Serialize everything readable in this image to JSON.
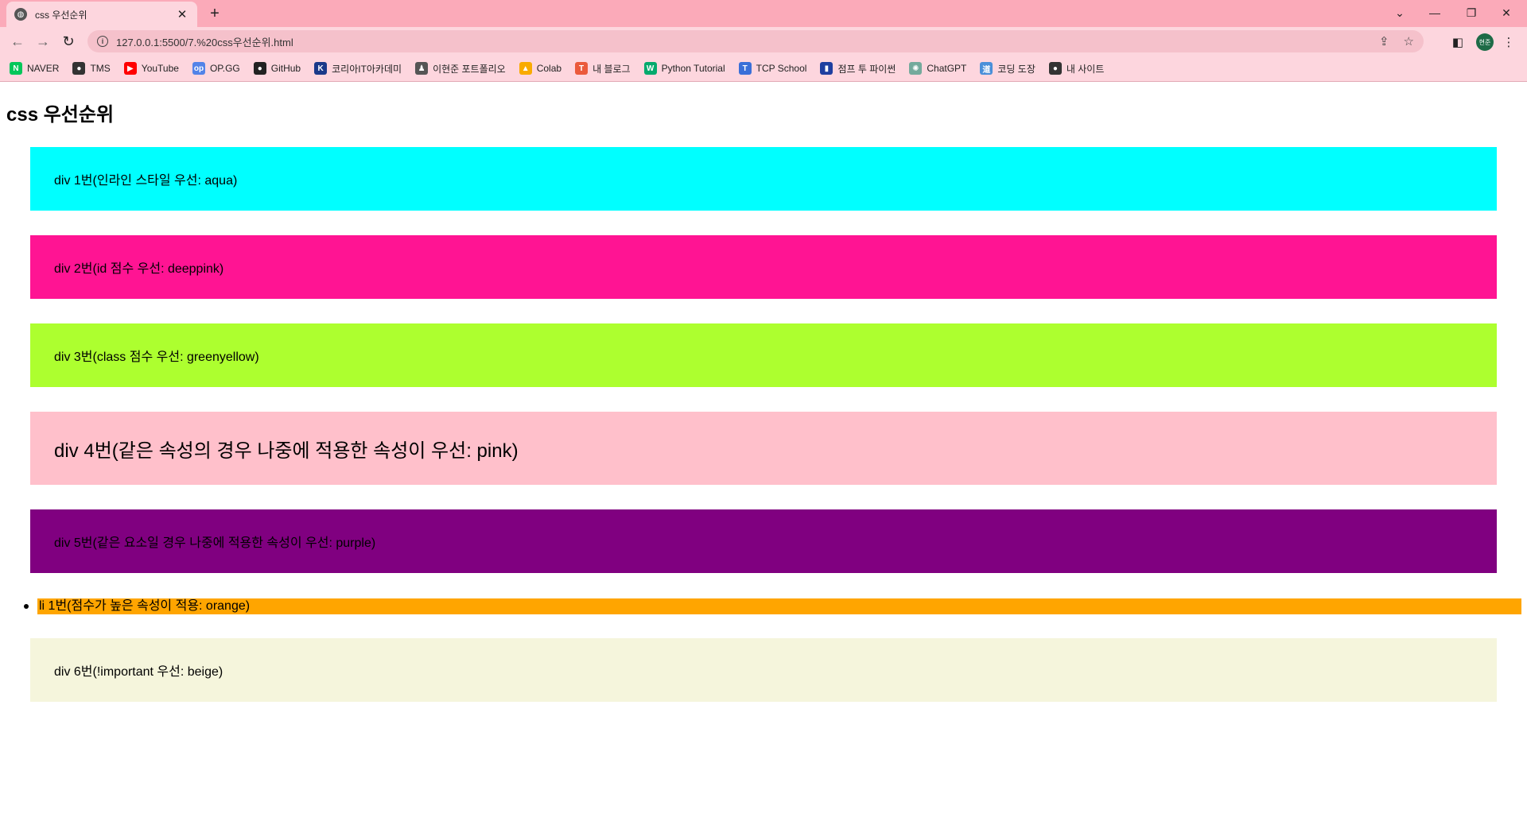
{
  "browser": {
    "tab": {
      "title": "css 우선순위",
      "close": "✕"
    },
    "new_tab": "+",
    "window": {
      "minimize": "—",
      "restore": "❐",
      "close": "✕",
      "tab_search": "⌄"
    },
    "nav": {
      "back": "←",
      "forward": "→",
      "reload": "↻"
    },
    "address": {
      "info": "i",
      "url": "127.0.0.1:5500/7.%20css우선순위.html",
      "share": "⇪",
      "star": "☆"
    },
    "side_panel": "◧",
    "profile": "현준",
    "menu": "⋮",
    "bookmarks": [
      {
        "label": "NAVER",
        "icon": "N",
        "color": "#03c75a"
      },
      {
        "label": "TMS",
        "icon": "●",
        "color": "#333333"
      },
      {
        "label": "YouTube",
        "icon": "▶",
        "color": "#ff0000"
      },
      {
        "label": "OP.GG",
        "icon": "op",
        "color": "#5383e8"
      },
      {
        "label": "GitHub",
        "icon": "●",
        "color": "#222222"
      },
      {
        "label": "코리아IT아카데미",
        "icon": "K",
        "color": "#1b3a8a"
      },
      {
        "label": "이현준 포트폴리오",
        "icon": "♟",
        "color": "#555555"
      },
      {
        "label": "Colab",
        "icon": "▲",
        "color": "#f9ab00"
      },
      {
        "label": "내 블로그",
        "icon": "T",
        "color": "#eb5a3c"
      },
      {
        "label": "Python Tutorial",
        "icon": "W",
        "color": "#04aa6d"
      },
      {
        "label": "TCP School",
        "icon": "T",
        "color": "#3a6fd8"
      },
      {
        "label": "점프 투 파이썬",
        "icon": "▮",
        "color": "#1f3fa0"
      },
      {
        "label": "ChatGPT",
        "icon": "✺",
        "color": "#74aa9c"
      },
      {
        "label": "코딩 도장",
        "icon": "道",
        "color": "#4a8fd9"
      },
      {
        "label": "내 사이트",
        "icon": "●",
        "color": "#333333"
      }
    ]
  },
  "page": {
    "title": "css 우선순위",
    "boxes": [
      {
        "text": "div 1번(인라인 스타일 우선: aqua)",
        "bg": "#00ffff",
        "fg": "#000000"
      },
      {
        "text": "div 2번(id 점수 우선: deeppink)",
        "bg": "#ff1493",
        "fg": "#000000"
      },
      {
        "text": "div 3번(class 점수 우선: greenyellow)",
        "bg": "#adff2f",
        "fg": "#000000"
      },
      {
        "text": "div 4번(같은 속성의 경우 나중에 적용한 속성이 우선: pink)",
        "bg": "#ffc0cb",
        "fg": "#000000"
      },
      {
        "text": "div 5번(같은 요소일 경우 나중에 적용한 속성이 우선: purple)",
        "bg": "#800080",
        "fg": "#000000"
      },
      {
        "text": "div 6번(!important 우선: beige)",
        "bg": "#f5f5dc",
        "fg": "#000000"
      }
    ],
    "list_item": {
      "text": "li 1번(점수가 높은 속성이 적용: orange)",
      "bg": "#ffa500"
    }
  }
}
